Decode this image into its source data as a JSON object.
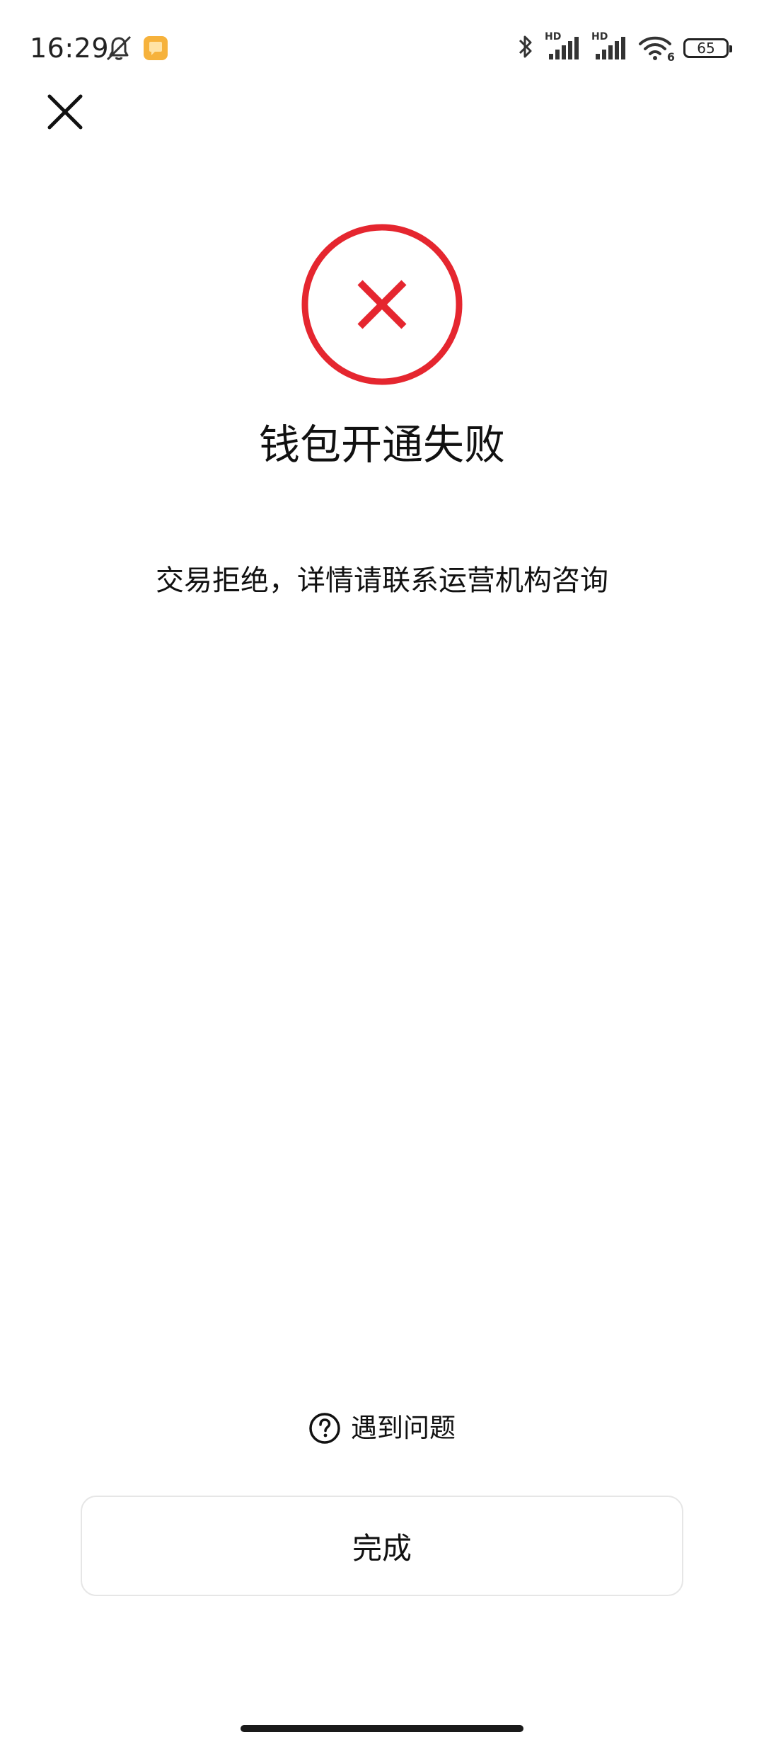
{
  "status_bar": {
    "time": "16:29",
    "battery": "65",
    "icons": [
      "mute-icon",
      "app-notification-icon",
      "bluetooth-icon",
      "signal-hd-1-icon",
      "signal-hd-2-icon",
      "wifi-icon",
      "battery-icon"
    ],
    "signal_label_1": "HD",
    "signal_label_2": "HD",
    "wifi_label": "6"
  },
  "header": {
    "close_icon": "close-icon"
  },
  "result": {
    "status": "failure",
    "icon": "error-circle-x-icon",
    "accent_color": "#e5262f",
    "title": "钱包开通失败",
    "message": "交易拒绝，详情请联系运营机构咨询"
  },
  "help": {
    "icon": "question-circle-icon",
    "label": "遇到问题"
  },
  "actions": {
    "done_label": "完成"
  }
}
